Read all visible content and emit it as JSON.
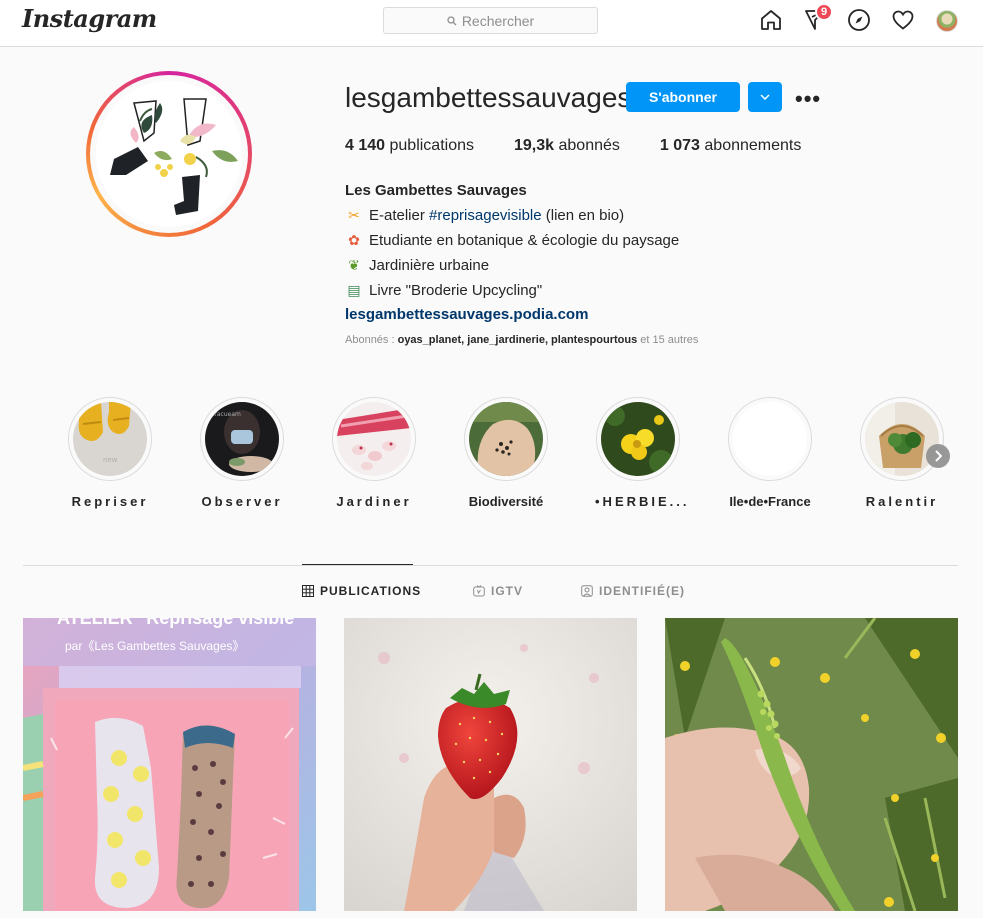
{
  "nav": {
    "logo": "Instagram",
    "search_placeholder": "Rechercher",
    "activity_badge": "9",
    "icons": [
      "home-icon",
      "direct-icon",
      "explore-icon",
      "heart-icon",
      "profile-avatar"
    ]
  },
  "profile": {
    "username": "lesgambettessauvages",
    "follow_label": "S'abonner",
    "more_label": "•••",
    "stats": {
      "posts_count": "4 140",
      "posts_label": "publications",
      "followers_count": "19,3k",
      "followers_label": "abonnés",
      "following_count": "1 073",
      "following_label": "abonnements"
    },
    "bio": {
      "name": "Les Gambettes Sauvages",
      "line1_prefix": "E-atelier ",
      "line1_hashtag": "#reprisagevisible",
      "line1_suffix": " (lien en bio)",
      "line2": "Etudiante en botanique & écologie du paysage",
      "line3": "Jardinière urbaine",
      "line4": "Livre \"Broderie Upcycling\"",
      "link": "lesgambettessauvages.podia.com"
    },
    "followed_by": {
      "prefix": "Abonnés : ",
      "names": "oyas_planet, jane_jardinerie, plantespourtous",
      "suffix": " et 15 autres"
    }
  },
  "highlights": [
    {
      "label": "Repriser"
    },
    {
      "label": "Observer"
    },
    {
      "label": "Jardiner"
    },
    {
      "label": "Biodiversité"
    },
    {
      "label": "•HERBIE..."
    },
    {
      "label": "Ile•de•France"
    },
    {
      "label": "Ralentir"
    }
  ],
  "tabs": [
    {
      "label": "PUBLICATIONS",
      "active": true
    },
    {
      "label": "IGTV",
      "active": false
    },
    {
      "label": "IDENTIFIÉ(E)",
      "active": false
    }
  ],
  "posts": [
    {
      "overlay_title": "ATELIER \"Reprisage visible\"",
      "overlay_sub": "par《Les Gambettes Sauvages》"
    },
    {
      "description": "strawberry"
    },
    {
      "description": "grass seed"
    }
  ],
  "colors": {
    "accent": "#0095f6",
    "link": "#00376b",
    "badge": "#ed4956"
  }
}
